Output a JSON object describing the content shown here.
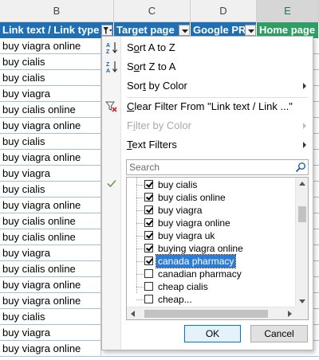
{
  "columns": [
    "B",
    "C",
    "D",
    "E"
  ],
  "headers": {
    "b": "Link text / Link type",
    "c": "Target page",
    "d": "Google PR",
    "e": "Home page G"
  },
  "rows": [
    "buy viagra online",
    "buy cialis",
    "buy cialis",
    "buy viagra",
    "buy cialis online",
    "buy viagra online",
    "buy cialis",
    "buy viagra online",
    "buy viagra",
    "buy cialis",
    "buy viagra online",
    "buy cialis online",
    "buy cialis online",
    "buy viagra",
    "buy cialis online",
    "buy viagra online",
    "buy viagra online",
    "buy cialis",
    "buy viagra",
    "buy viagra online"
  ],
  "menu": {
    "sort_az_pre": "S",
    "sort_az_u": "o",
    "sort_az_post": "rt A to Z",
    "sort_za_pre": "S",
    "sort_za_u": "o",
    "sort_za_post": "rt Z to A",
    "sort_color_pre": "Sor",
    "sort_color_u": "t",
    "sort_color_post": " by Color",
    "clear_pre": "",
    "clear_u": "C",
    "clear_post": "lear Filter From \"Link text / Link ...\"",
    "filter_color_pre": "F",
    "filter_color_u": "i",
    "filter_color_post": "lter by Color",
    "text_filters_pre": "",
    "text_filters_u": "T",
    "text_filters_post": "ext Filters"
  },
  "search": {
    "placeholder": "Search"
  },
  "list_items": [
    {
      "label": "buy cialis",
      "checked": true
    },
    {
      "label": "buy cialis online",
      "checked": true
    },
    {
      "label": "buy viagra",
      "checked": true
    },
    {
      "label": "buy viagra online",
      "checked": true
    },
    {
      "label": "buy viagra uk",
      "checked": true
    },
    {
      "label": "buying viagra online",
      "checked": true
    },
    {
      "label": "canada pharmacy",
      "checked": true,
      "selected": true
    },
    {
      "label": "canadian pharmacy",
      "checked": false
    },
    {
      "label": "cheap cialis",
      "checked": false
    },
    {
      "label": "cheap...",
      "checked": false
    }
  ],
  "buttons": {
    "ok": "OK",
    "cancel": "Cancel"
  },
  "colors": {
    "header_blue": "#1f6fb4",
    "header_green": "#2f9e62",
    "selection": "#2d7cd4"
  }
}
